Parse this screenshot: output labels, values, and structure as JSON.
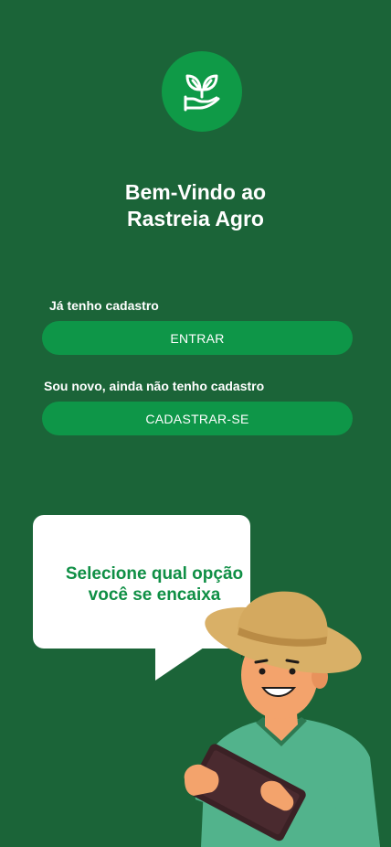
{
  "app": {
    "title_line1": "Bem-Vindo ao",
    "title_line2": "Rastreia Agro",
    "logo_icon": "hand-plant-icon"
  },
  "existing_user": {
    "label": "Já tenho cadastro",
    "button_label": "ENTRAR"
  },
  "new_user": {
    "label": "Sou novo, ainda não tenho cadastro",
    "button_label": "CADASTRAR-SE"
  },
  "bubble": {
    "line1": "Selecione qual opção",
    "line2": "você se encaixa"
  },
  "colors": {
    "background": "#1b6438",
    "accent": "#0e9648",
    "bubble_text": "#0f8f45"
  }
}
